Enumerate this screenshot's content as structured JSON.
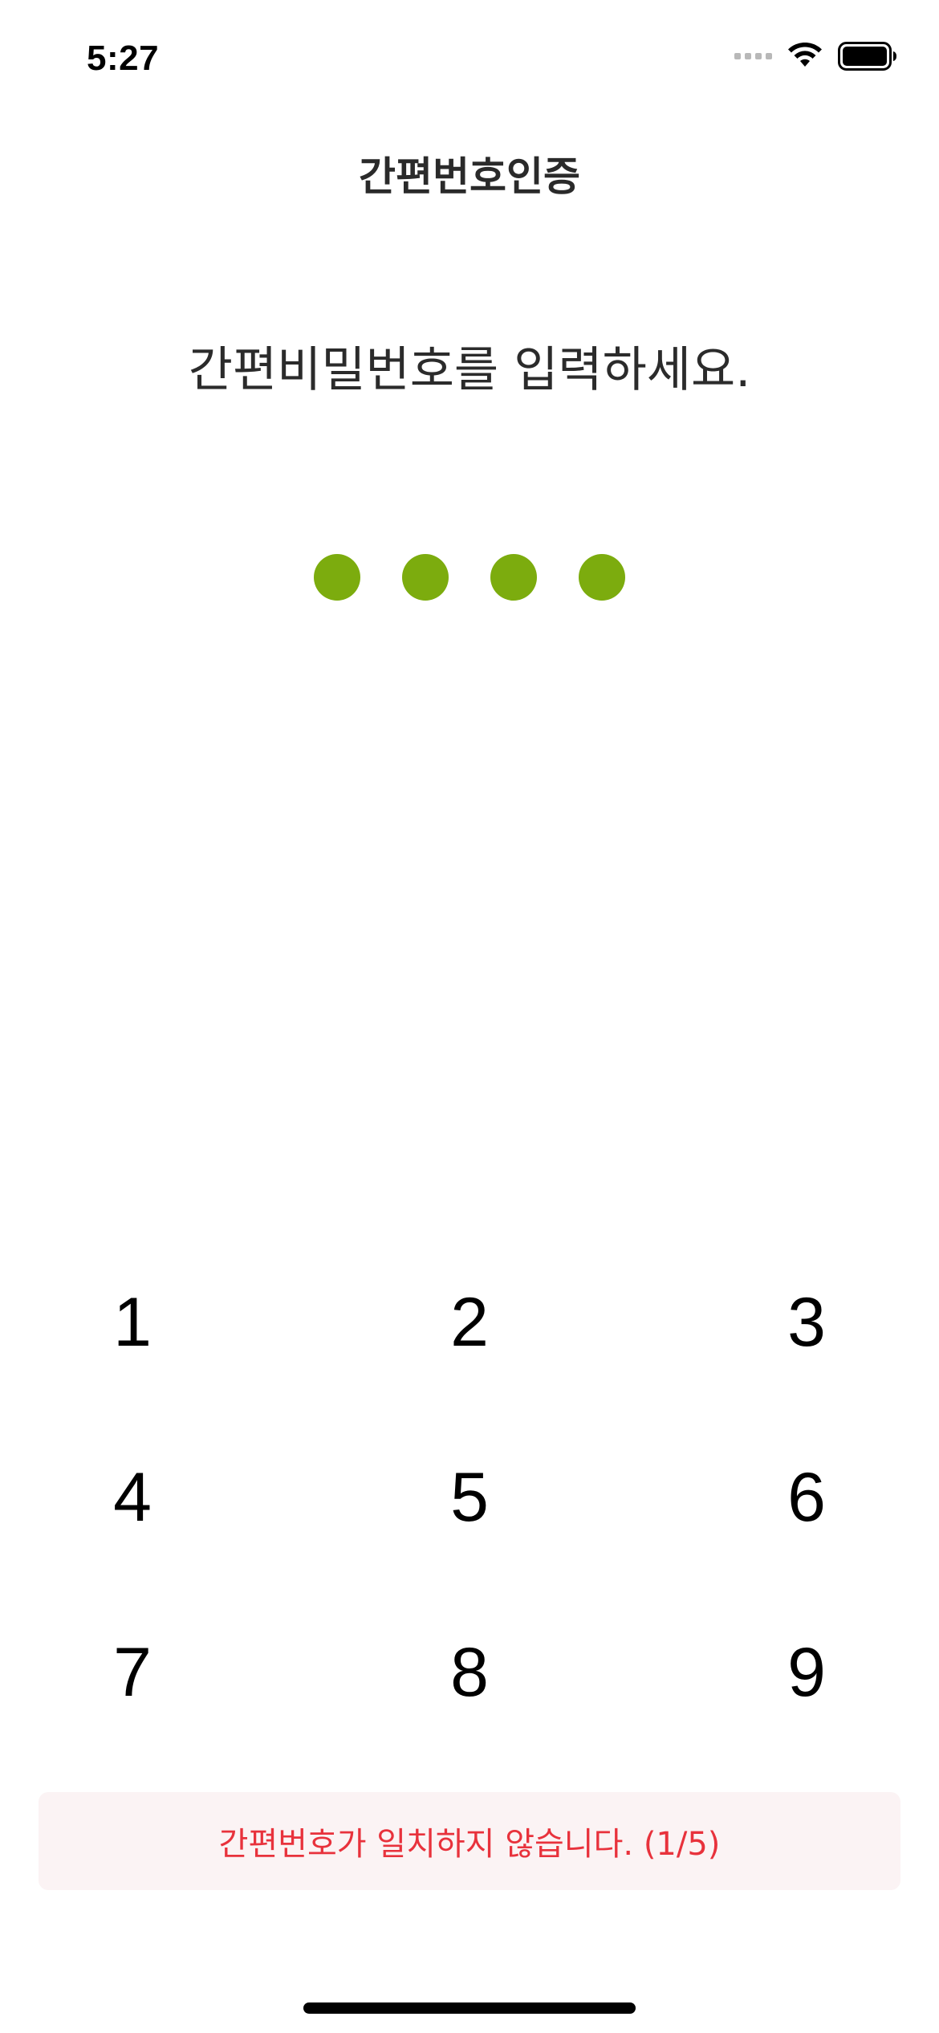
{
  "status_bar": {
    "time": "5:27",
    "icons": [
      "signal-icon",
      "wifi-icon",
      "battery-icon"
    ]
  },
  "header": {
    "title": "간편번호인증"
  },
  "prompt": {
    "text": "간편비밀번호를 입력하세요."
  },
  "pin": {
    "length": 4,
    "filled": 4,
    "color": "#7cac0e"
  },
  "keypad": {
    "keys": [
      "1",
      "2",
      "3",
      "4",
      "5",
      "6",
      "7",
      "8",
      "9"
    ]
  },
  "error": {
    "message": "간편번호가 일치하지 않습니다. (1/5)",
    "color": "#e8323c",
    "background": "#fbf3f4"
  }
}
